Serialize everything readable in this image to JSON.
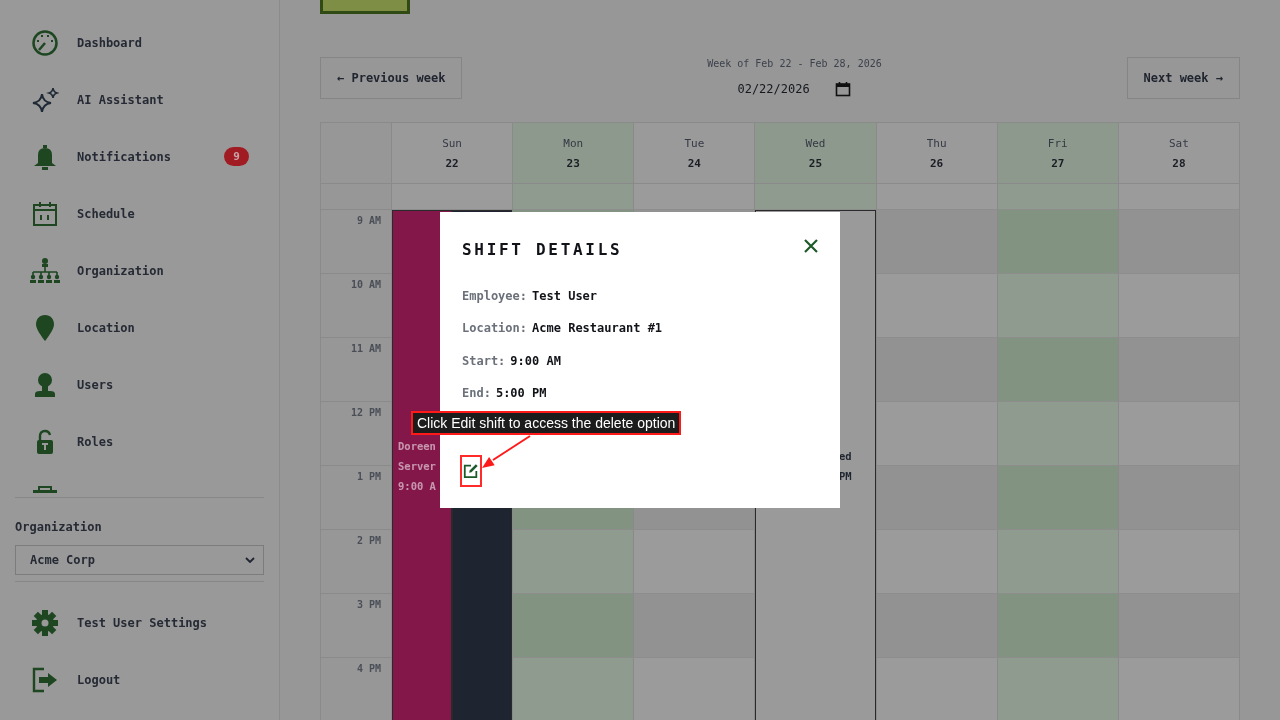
{
  "sidebar": {
    "nav_items": [
      {
        "label": "Dashboard"
      },
      {
        "label": "AI Assistant"
      },
      {
        "label": "Notifications",
        "badge": "9"
      },
      {
        "label": "Schedule"
      },
      {
        "label": "Organization"
      },
      {
        "label": "Location"
      },
      {
        "label": "Users"
      },
      {
        "label": "Roles"
      }
    ],
    "organization": {
      "label": "Organization",
      "value": "Acme Corp"
    },
    "bottom_items": [
      {
        "label": "Test User Settings"
      },
      {
        "label": "Logout"
      }
    ]
  },
  "week_nav": {
    "previous": "← Previous week",
    "range": "Week of Feb 22 - Feb 28, 2026",
    "date": "02/22/2026",
    "next": "Next week →"
  },
  "calendar": {
    "days": [
      {
        "name": "Sun",
        "date": "22",
        "highlighted": false,
        "events": [
          {
            "color": "#83174a",
            "lines": [
              "Doreen",
              "Server",
              "9:00 A"
            ]
          },
          {
            "color": "#1f2530"
          }
        ]
      },
      {
        "name": "Mon",
        "date": "23",
        "highlighted": true
      },
      {
        "name": "Tue",
        "date": "24",
        "highlighted": false
      },
      {
        "name": "Wed",
        "date": "25",
        "highlighted": true,
        "events": [
          {
            "color": "#9a9a9a",
            "lines": [
              "ed",
              "PM"
            ]
          }
        ]
      },
      {
        "name": "Thu",
        "date": "26",
        "highlighted": false
      },
      {
        "name": "Fri",
        "date": "27",
        "highlighted": true
      },
      {
        "name": "Sat",
        "date": "28",
        "highlighted": false
      }
    ],
    "hours": [
      "9 AM",
      "10 AM",
      "11 AM",
      "12 PM",
      "1 PM",
      "2 PM",
      "3 PM",
      "4 PM"
    ]
  },
  "shift_modal": {
    "title": "SHIFT DETAILS",
    "fields": [
      {
        "label": "Employee:",
        "value": "Test User"
      },
      {
        "label": "Location:",
        "value": "Acme Restaurant #1"
      },
      {
        "label": "Start:",
        "value": "9:00 AM"
      },
      {
        "label": "End:",
        "value": "5:00 PM"
      }
    ]
  },
  "callout": {
    "text": "Click Edit shift to access the delete option"
  }
}
